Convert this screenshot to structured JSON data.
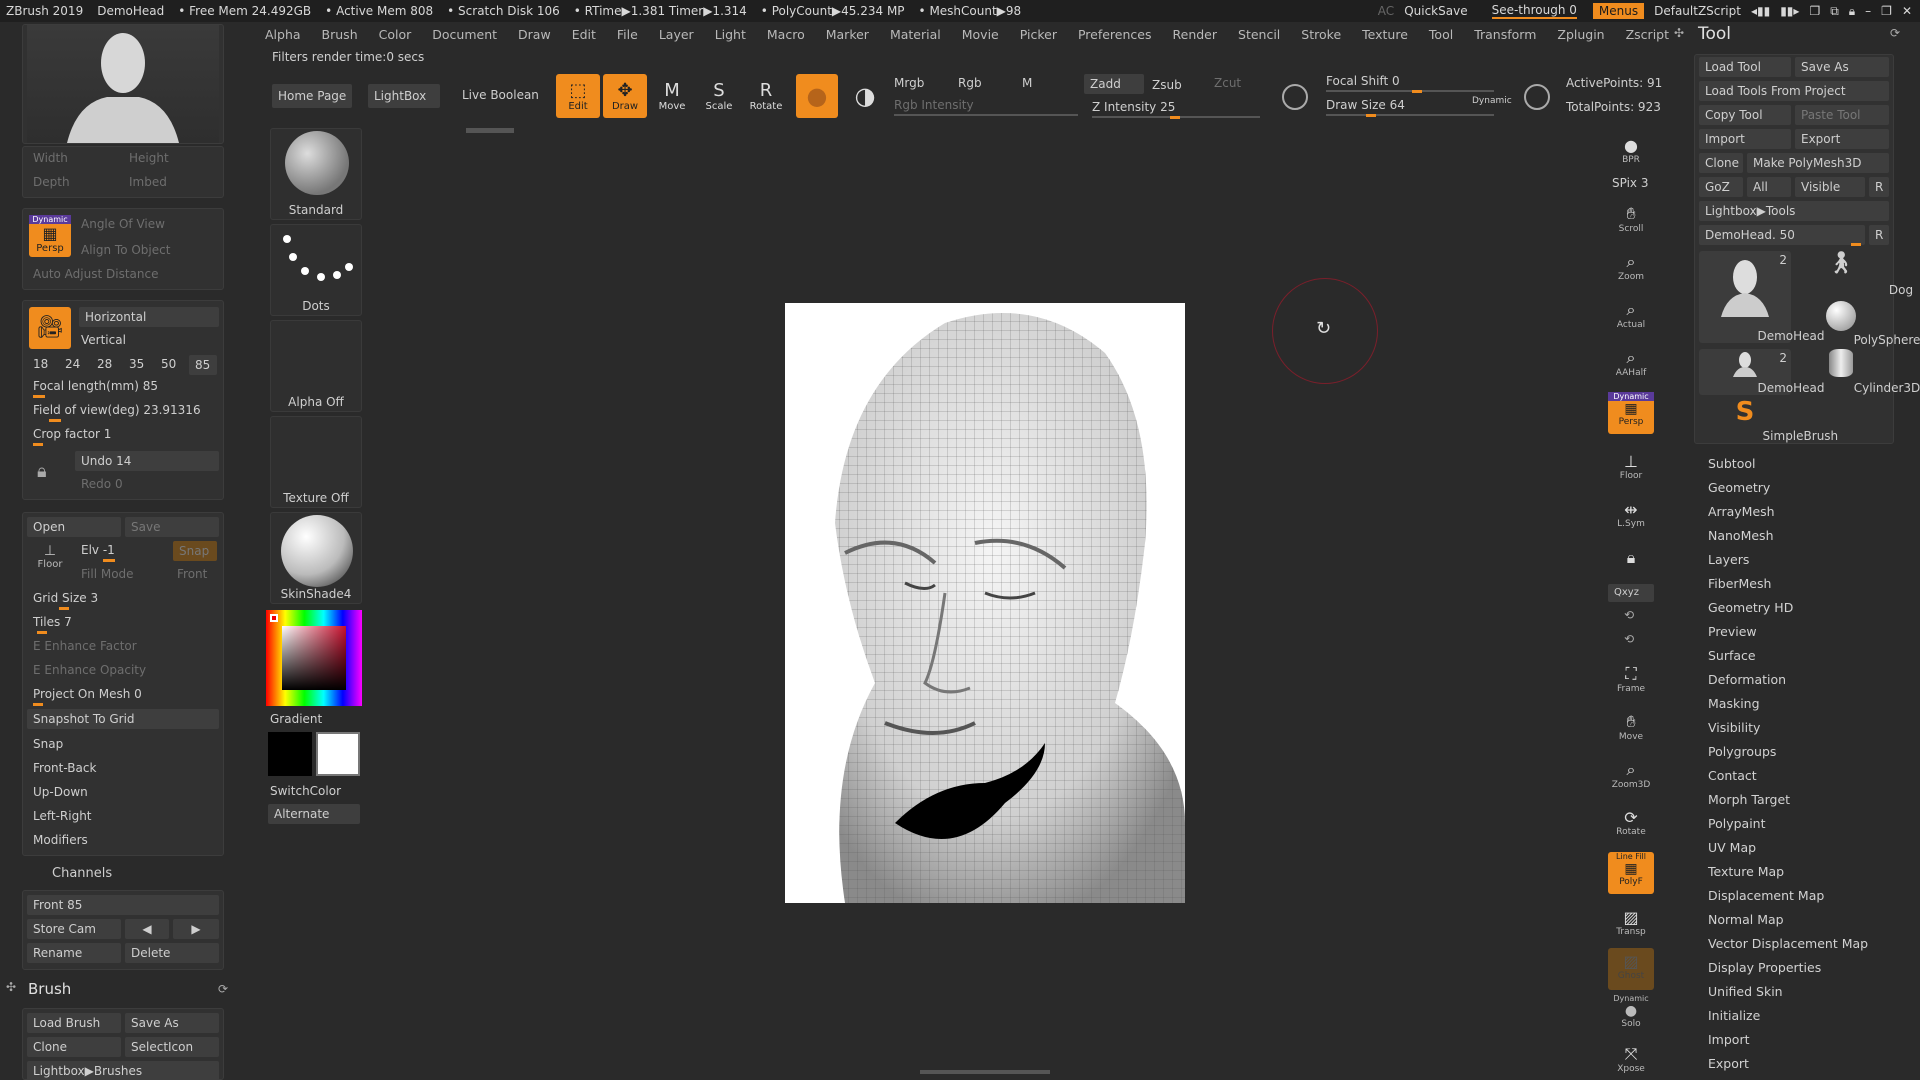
{
  "titlebar": {
    "app": "ZBrush 2019",
    "doc": "DemoHead",
    "free_mem": "• Free Mem 24.492GB",
    "active_mem": "• Active Mem 808",
    "scratch": "• Scratch Disk 106",
    "rtime": "• RTime▶1.381 Timer▶1.314",
    "polycount": "• PolyCount▶45.234 MP",
    "meshcount": "• MeshCount▶98",
    "ac": "AC",
    "quicksave": "QuickSave",
    "seethrough": "See-through  0",
    "menus": "Menus",
    "script": "DefaultZScript"
  },
  "menubar": [
    "Alpha",
    "Brush",
    "Color",
    "Document",
    "Draw",
    "Edit",
    "File",
    "Layer",
    "Light",
    "Macro",
    "Marker",
    "Material",
    "Movie",
    "Picker",
    "Preferences",
    "Render",
    "Stencil",
    "Stroke",
    "Texture",
    "Tool",
    "Transform",
    "Zplugin",
    "Zscript"
  ],
  "filters_text": "Filters render time:0 secs",
  "toolbar": {
    "home": "Home Page",
    "lightbox": "LightBox",
    "live_boolean": "Live Boolean",
    "edit": "Edit",
    "draw": "Draw",
    "move": "Move",
    "scale": "Scale",
    "rotate": "Rotate",
    "mrgb": "Mrgb",
    "rgb": "Rgb",
    "m": "M",
    "rgb_intensity": "Rgb Intensity",
    "zadd": "Zadd",
    "zsub": "Zsub",
    "zcut": "Zcut",
    "z_intensity": "Z Intensity 25",
    "focal_shift": "Focal Shift 0",
    "draw_size": "Draw Size 64",
    "dynamic": "Dynamic",
    "active_points": "ActivePoints: 91",
    "total_points": "TotalPoints: 923"
  },
  "left": {
    "width": "Width",
    "height": "Height",
    "depth": "Depth",
    "imbed": "Imbed",
    "persp_top": "Dynamic",
    "persp": "Persp",
    "angle_of_view": "Angle Of View",
    "align_to_object": "Align To Object",
    "auto_adjust": "Auto Adjust Distance",
    "horizontal": "Horizontal",
    "vertical": "Vertical",
    "focal_presets": [
      "18",
      "24",
      "28",
      "35",
      "50",
      "85"
    ],
    "focal_length": "Focal length(mm) 85",
    "fov": "Field of view(deg) 23.91316",
    "crop": "Crop factor 1",
    "undo": "Undo 14",
    "redo": "Redo 0",
    "open": "Open",
    "save": "Save",
    "elv": "Elv -1",
    "snap_dim": "Snap",
    "floor": "Floor",
    "fill_mode": "Fill Mode",
    "front_dim": "Front",
    "grid_size": "Grid Size 3",
    "tiles": "Tiles 7",
    "e_enhance_factor": "E Enhance Factor",
    "e_enhance_opacity": "E Enhance Opacity",
    "project_on_mesh": "Project On Mesh 0",
    "snapshot": "Snapshot To Grid",
    "snap": "Snap",
    "front_back": "Front-Back",
    "up_down": "Up-Down",
    "left_right": "Left-Right",
    "modifiers": "Modifiers",
    "channels": "Channels",
    "front85": "Front 85",
    "store_cam": "Store Cam",
    "rename": "Rename",
    "delete": "Delete",
    "brush_title": "Brush",
    "load_brush": "Load Brush",
    "save_as": "Save As",
    "clone": "Clone",
    "selicon": "SelectIcon",
    "lightbox_brushes": "Lightbox▶Brushes"
  },
  "brushcol": {
    "standard": "Standard",
    "dots": "Dots",
    "alpha_off": "Alpha Off",
    "texture_off": "Texture Off",
    "skinshade": "SkinShade4",
    "gradient": "Gradient",
    "switchcolor": "SwitchColor",
    "alternate": "Alternate"
  },
  "shelf": {
    "bpr": "BPR",
    "spix": "SPix 3",
    "scroll": "Scroll",
    "zoom": "Zoom",
    "actual": "Actual",
    "aahalf": "AAHalf",
    "persp_top": "Dynamic",
    "persp": "Persp",
    "floor": "Floor",
    "lsym": "L.Sym",
    "xyz": "Qxyz",
    "frame": "Frame",
    "move": "Move",
    "zoom3d": "Zoom3D",
    "rotate": "Rotate",
    "polyf_top": "Line Fill",
    "polyf": "PolyF",
    "transp": "Transp",
    "ghost": "Ghost",
    "solo_top": "Dynamic",
    "solo": "Solo",
    "xpose": "Xpose"
  },
  "right": {
    "title": "Tool",
    "load_tool": "Load Tool",
    "save_as": "Save As",
    "load_from_project": "Load Tools From Project",
    "copy_tool": "Copy Tool",
    "paste_tool": "Paste Tool",
    "import": "Import",
    "export": "Export",
    "clone": "Clone",
    "make_polymesh": "Make PolyMesh3D",
    "goz": "GoZ",
    "all": "All",
    "visible": "Visible",
    "r": "R",
    "lightbox_tools": "Lightbox▶Tools",
    "demohead50": "DemoHead. 50",
    "thumbs": [
      {
        "label": "DemoHead",
        "count": "2"
      },
      {
        "label": "Dog",
        "count": ""
      },
      {
        "label": "PolySphere",
        "count": ""
      },
      {
        "label": "DemoHead",
        "count": "2"
      },
      {
        "label": "Cylinder3D",
        "count": ""
      },
      {
        "label": "SimpleBrush",
        "count": ""
      }
    ],
    "menu": [
      "Subtool",
      "Geometry",
      "ArrayMesh",
      "NanoMesh",
      "Layers",
      "FiberMesh",
      "Geometry HD",
      "Preview",
      "Surface",
      "Deformation",
      "Masking",
      "Visibility",
      "Polygroups",
      "Contact",
      "Morph Target",
      "Polypaint",
      "UV Map",
      "Texture Map",
      "Displacement Map",
      "Normal Map",
      "Vector Displacement Map",
      "Display Properties",
      "Unified Skin",
      "Initialize",
      "Import",
      "Export"
    ]
  },
  "colors": {
    "accent": "#f08c1e",
    "bg": "#2a2a2a",
    "panel": "#313131"
  }
}
